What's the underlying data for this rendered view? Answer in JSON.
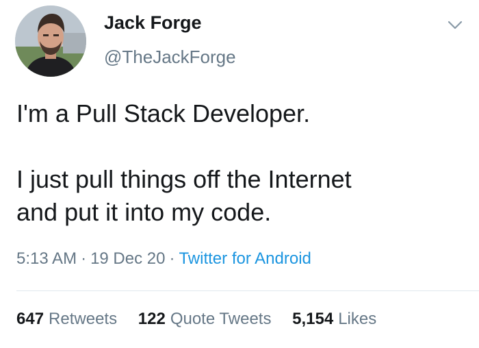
{
  "author": {
    "name": "Jack Forge",
    "handle": "@TheJackForge"
  },
  "tweet": {
    "lines": [
      "I'm a Pull Stack Developer.",
      "I just pull things off the Internet",
      "and put it into my code."
    ]
  },
  "meta": {
    "time": "5:13 AM",
    "date": "19 Dec 20",
    "source": "Twitter for Android"
  },
  "stats": {
    "retweets": {
      "count": "647",
      "label": "Retweets"
    },
    "quote_tweets": {
      "count": "122",
      "label": "Quote Tweets"
    },
    "likes": {
      "count": "5,154",
      "label": "Likes"
    }
  },
  "icons": {
    "menu": "chevron-down-icon"
  },
  "colors": {
    "text": "#14171a",
    "secondary": "#657786",
    "link": "#1b95e0",
    "divider": "#e1e8ed"
  }
}
